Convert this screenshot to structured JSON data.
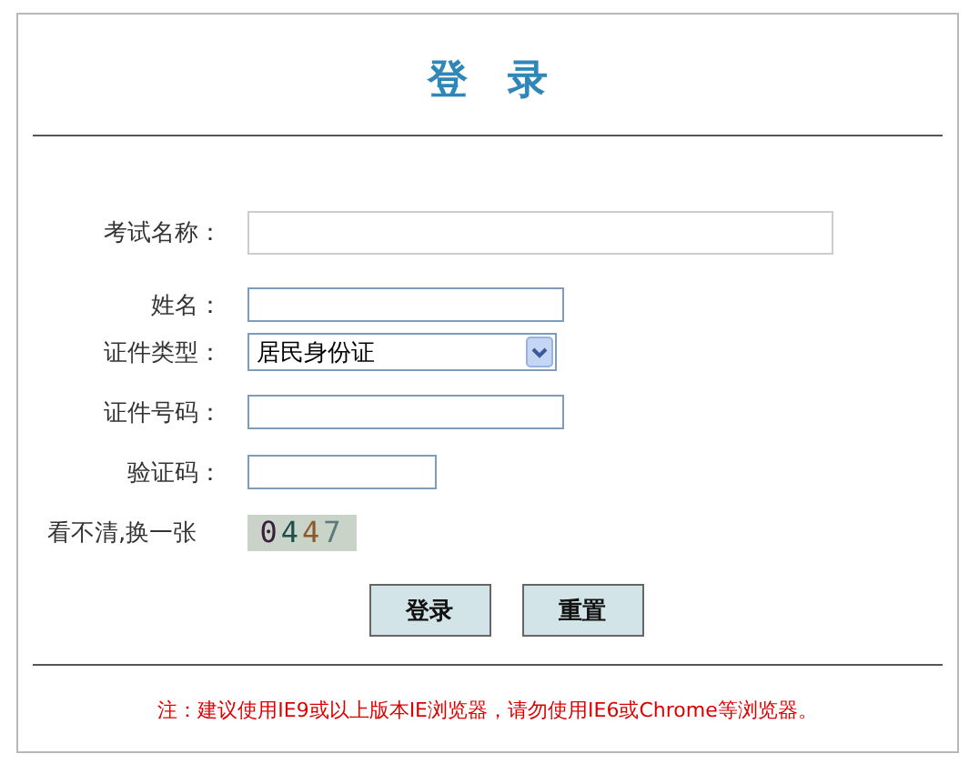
{
  "title": "登 录",
  "fields": [
    {
      "kind": "text",
      "label": "考试名称："
    },
    {
      "kind": "text",
      "label": "姓名："
    },
    {
      "kind": "select",
      "label": "证件类型：",
      "value": "居民身份证"
    },
    {
      "kind": "text",
      "label": "证件号码："
    },
    {
      "kind": "text",
      "label": "验证码："
    }
  ],
  "captcha": {
    "refresh_link": "看不清,换一张",
    "code": "0447"
  },
  "buttons": [
    "登录",
    "重置"
  ],
  "note": "注：建议使用IE9或以上版本IE浏览器，请勿使用IE6或Chrome等浏览器。"
}
